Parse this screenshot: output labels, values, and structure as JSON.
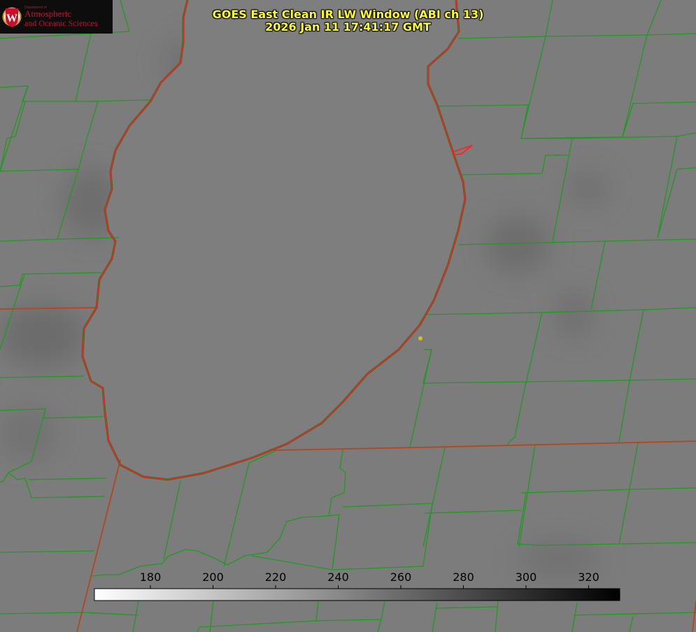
{
  "title": {
    "line1": "GOES East Clean IR LW Window (ABI ch 13)",
    "line2": "2026 Jan 11 17:41:17 GMT"
  },
  "logo": {
    "dept": "Department of",
    "line1": "Atmospheric",
    "line2": "and Oceanic Sciences",
    "crest_letter": "W"
  },
  "colorbar": {
    "ticks": [
      "180",
      "200",
      "220",
      "240",
      "260",
      "280",
      "300",
      "320"
    ],
    "colormap": "white-to-black"
  },
  "colors": {
    "shoreline": "#ff2020",
    "county_lines": "#1f9a1f",
    "state_lines": "#b5461c",
    "title_text": "#ffff22",
    "marker": "#d4c21a"
  }
}
